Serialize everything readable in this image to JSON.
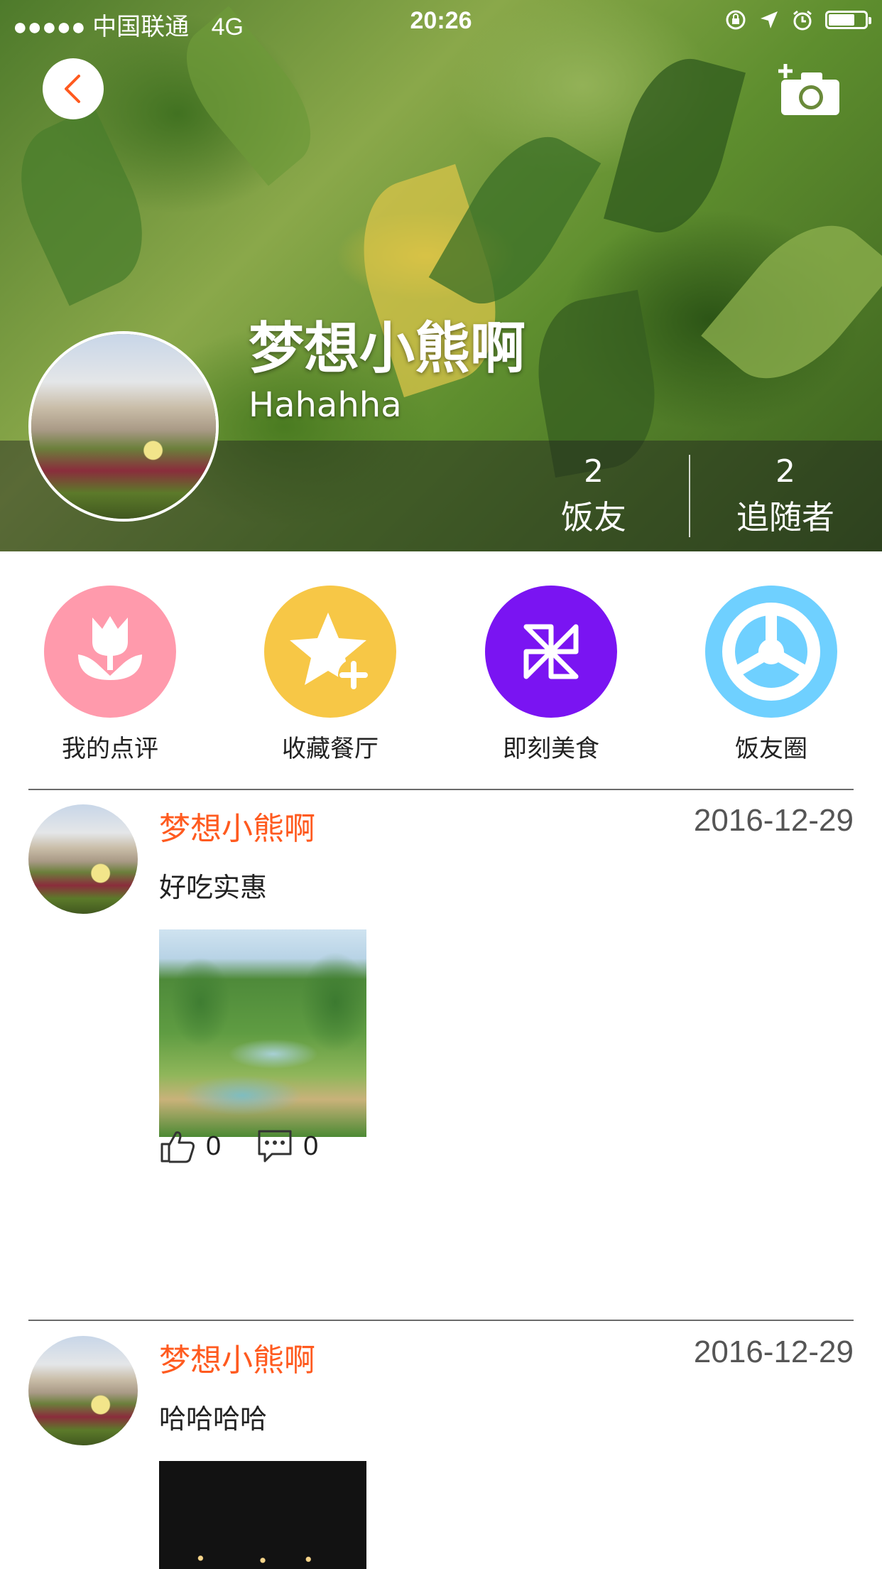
{
  "status_bar": {
    "signal": "●●●●●",
    "carrier": "中国联通",
    "network": "4G",
    "time": "20:26",
    "battery_level": 0.75
  },
  "header": {
    "back_icon": "chevron-left-icon",
    "camera_icon": "camera-add-icon",
    "name": "梦想小熊啊",
    "bio": "Hahahha",
    "stats": [
      {
        "count": "2",
        "label": "饭友"
      },
      {
        "count": "2",
        "label": "追随者"
      }
    ]
  },
  "shortcuts": [
    {
      "label": "我的点评",
      "icon": "tulip-icon",
      "color": "#ff9aac"
    },
    {
      "label": "收藏餐厅",
      "icon": "star-plus-icon",
      "color": "#f7c746"
    },
    {
      "label": "即刻美食",
      "icon": "pinwheel-icon",
      "color": "#7a14f2"
    },
    {
      "label": "饭友圈",
      "icon": "wheel-icon",
      "color": "#6fd0ff"
    }
  ],
  "posts": [
    {
      "author": "梦想小熊啊",
      "date": "2016-12-29",
      "text": "好吃实惠",
      "likes": "0",
      "comments": "0"
    },
    {
      "author": "梦想小熊啊",
      "date": "2016-12-29",
      "text": "哈哈哈哈"
    }
  ],
  "colors": {
    "accent": "#ff5a1f",
    "divider": "#6b6b6b"
  }
}
